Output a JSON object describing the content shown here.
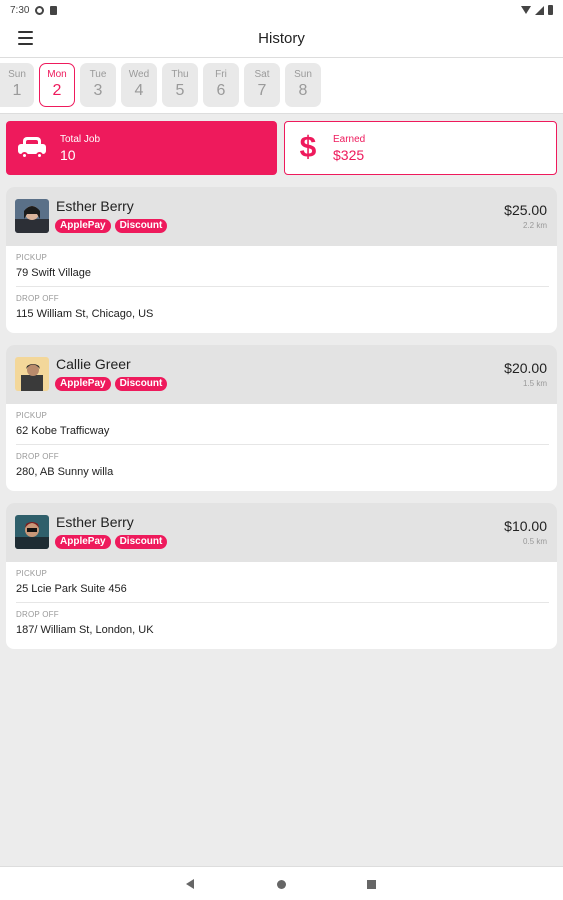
{
  "status_bar": {
    "time": "7:30"
  },
  "app_bar": {
    "title": "History"
  },
  "days": [
    {
      "name": "Sun",
      "date": "1",
      "active": false
    },
    {
      "name": "Mon",
      "date": "2",
      "active": true
    },
    {
      "name": "Tue",
      "date": "3",
      "active": false
    },
    {
      "name": "Wed",
      "date": "4",
      "active": false
    },
    {
      "name": "Thu",
      "date": "5",
      "active": false
    },
    {
      "name": "Fri",
      "date": "6",
      "active": false
    },
    {
      "name": "Sat",
      "date": "7",
      "active": false
    },
    {
      "name": "Sun",
      "date": "8",
      "active": false
    }
  ],
  "summary": {
    "total_label": "Total Job",
    "total_value": "10",
    "earned_label": "Earned",
    "earned_value": "$325",
    "car_icon": "car-icon",
    "dollar_icon": "$"
  },
  "rides": [
    {
      "name": "Esther Berry",
      "badges": [
        "ApplePay",
        "Discount"
      ],
      "price": "$25.00",
      "distance": "2.2 km",
      "pickup_label": "PICKUP",
      "pickup": "79 Swift Village",
      "dropoff_label": "DROP OFF",
      "dropoff": "115 William St, Chicago, US"
    },
    {
      "name": "Callie Greer",
      "badges": [
        "ApplePay",
        "Discount"
      ],
      "price": "$20.00",
      "distance": "1.5 km",
      "pickup_label": "PICKUP",
      "pickup": "62 Kobe Trafficway",
      "dropoff_label": "DROP OFF",
      "dropoff": "280, AB Sunny willa"
    },
    {
      "name": "Esther Berry",
      "badges": [
        "ApplePay",
        "Discount"
      ],
      "price": "$10.00",
      "distance": "0.5 km",
      "pickup_label": "PICKUP",
      "pickup": "25 Lcie Park Suite 456",
      "dropoff_label": "DROP OFF",
      "dropoff": "187/ William St, London, UK"
    }
  ],
  "colors": {
    "accent": "#ee1a5c",
    "background": "#ececec",
    "card_header": "#e3e3e3"
  }
}
